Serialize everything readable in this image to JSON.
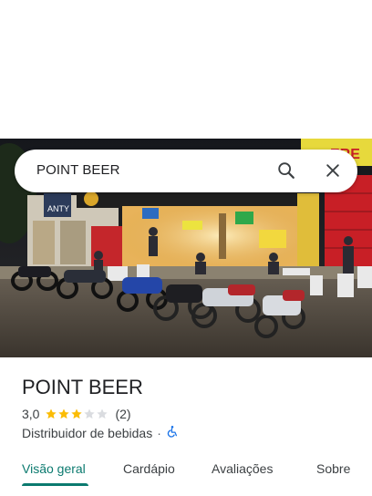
{
  "search": {
    "query": "POINT BEER"
  },
  "place": {
    "name": "POINT BEER",
    "rating": "3,0",
    "rating_value": 3,
    "rating_max": 5,
    "review_count": "(2)",
    "category": "Distribuidor de bebidas",
    "separator": "·",
    "accessibility_icon": "wheelchair-icon"
  },
  "photo": {
    "signs": {
      "left_store": "ANTY",
      "right_store": "ERE"
    }
  },
  "tabs": [
    {
      "label": "Visão geral",
      "active": true
    },
    {
      "label": "Cardápio",
      "active": false
    },
    {
      "label": "Avaliações",
      "active": false
    },
    {
      "label": "Sobre",
      "active": false
    }
  ],
  "colors": {
    "accent": "#0b7a6f",
    "star": "#fbbc04",
    "star_empty": "#dadce0"
  }
}
